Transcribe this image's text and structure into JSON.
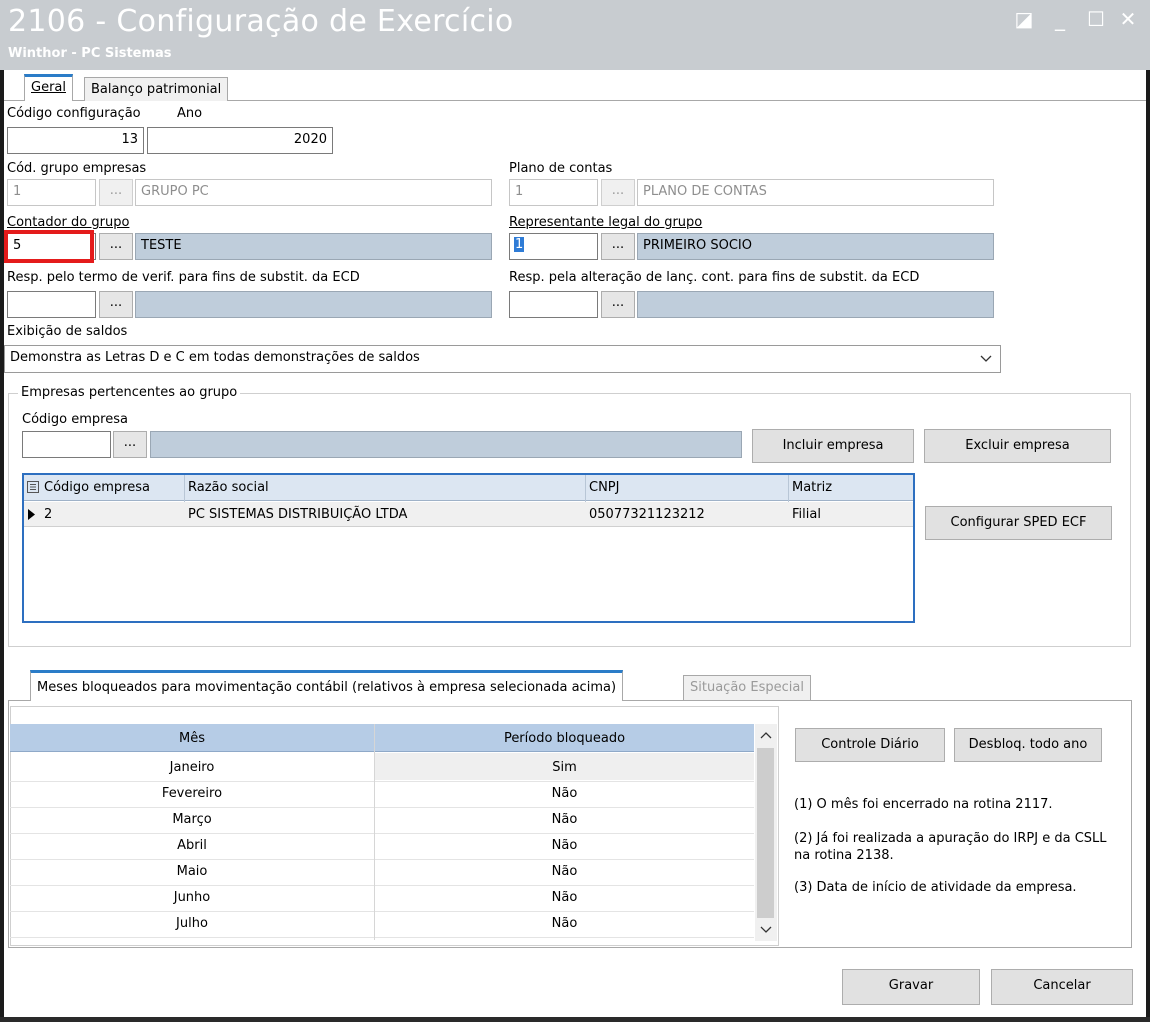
{
  "window": {
    "title": "2106 - Configuração de Exercício",
    "subtitle": "Winthor - PC Sistemas",
    "controls": {
      "restore": "◪",
      "minimize": "_",
      "maximize": "☐",
      "close": "✕"
    }
  },
  "tabs": [
    {
      "label": "Geral",
      "active": true
    },
    {
      "label": "Balanço patrimonial",
      "active": false
    }
  ],
  "fields": {
    "codigo_configuracao": {
      "label": "Código configuração",
      "value": "13"
    },
    "ano": {
      "label": "Ano",
      "value": "2020"
    },
    "grupo_empresas": {
      "label": "Cód. grupo empresas",
      "code": "1",
      "button": "...",
      "name": "GRUPO PC"
    },
    "plano_contas": {
      "label": "Plano de contas",
      "code": "1",
      "button": "...",
      "name": "PLANO DE CONTAS"
    },
    "contador_grupo": {
      "label": "Contador do grupo",
      "code": "5",
      "button": "...",
      "name": "TESTE"
    },
    "representante_legal": {
      "label": "Representante legal do grupo",
      "code": "1",
      "button": "...",
      "name": "PRIMEIRO SOCIO"
    },
    "resp_termo": {
      "label": "Resp. pelo termo de verif. para fins de substit. da ECD",
      "code": "",
      "button": "...",
      "name": ""
    },
    "resp_alteracao": {
      "label": "Resp. pela alteração de lanç. cont. para fins de substit. da ECD",
      "code": "",
      "button": "...",
      "name": ""
    },
    "exibicao_saldos": {
      "label": "Exibição de saldos",
      "value": "Demonstra as Letras D e C em todas demonstrações de saldos"
    }
  },
  "empresas": {
    "group_label": "Empresas pertencentes ao grupo",
    "codigo_label": "Código empresa",
    "codigo_value": "",
    "button": "...",
    "name_value": "",
    "incluir": "Incluir empresa",
    "excluir": "Excluir empresa",
    "configurar": "Configurar SPED ECF",
    "columns": [
      "Código empresa",
      "Razão social",
      "CNPJ",
      "Matriz"
    ],
    "rows": [
      {
        "codigo": "2",
        "razao": "PC SISTEMAS DISTRIBUIÇÃO LTDA",
        "cnpj": "05077321123212",
        "matriz": "Filial"
      }
    ]
  },
  "meses": {
    "tab_active": "Meses bloqueados para movimentação contábil (relativos à empresa selecionada acima)",
    "tab_inactive": "Situação Especial",
    "columns": [
      "Mês",
      "Período bloqueado"
    ],
    "rows": [
      {
        "mes": "Janeiro",
        "bloqueado": "Sim"
      },
      {
        "mes": "Fevereiro",
        "bloqueado": "Não"
      },
      {
        "mes": "Março",
        "bloqueado": "Não"
      },
      {
        "mes": "Abril",
        "bloqueado": "Não"
      },
      {
        "mes": "Maio",
        "bloqueado": "Não"
      },
      {
        "mes": "Junho",
        "bloqueado": "Não"
      },
      {
        "mes": "Julho",
        "bloqueado": "Não"
      }
    ],
    "controle_diario": "Controle Diário",
    "desbloq": "Desbloq. todo ano",
    "notes": [
      "(1)  O mês foi encerrado na rotina 2117.",
      "(2)  Já foi realizada a apuração do IRPJ e da CSLL na rotina 2138.",
      "(3)  Data de início de atividade da empresa."
    ]
  },
  "footer": {
    "gravar": "Gravar",
    "cancelar": "Cancelar"
  },
  "colors": {
    "titlebar": "#c8ccd0",
    "highlight": "#e41b1b",
    "selected": "#bfcddb",
    "tab_accent": "#2a7cc8"
  }
}
